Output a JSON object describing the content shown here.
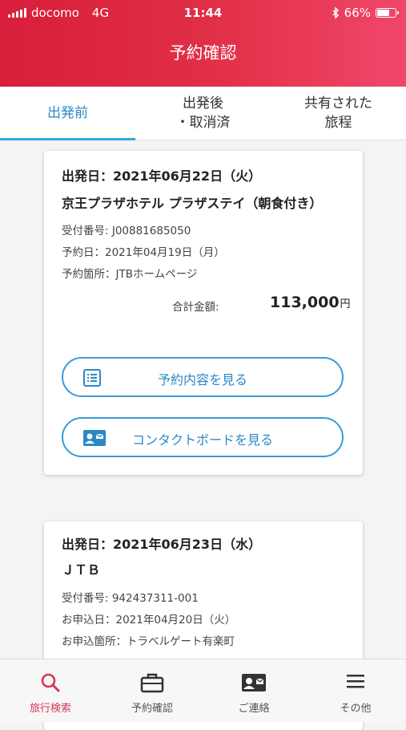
{
  "status_bar": {
    "carrier": "docomo",
    "network": "4G",
    "time": "11:44",
    "battery": "66%"
  },
  "header": {
    "title": "予約確認",
    "bg_colors": [
      "#d81e3a",
      "#f0476a"
    ]
  },
  "tabs": [
    {
      "line1": "出発前",
      "line2": "",
      "active": true
    },
    {
      "line1": "出発後",
      "line2": "・取消済",
      "active": false
    },
    {
      "line1": "共有された",
      "line2": "旅程",
      "active": false
    }
  ],
  "bookings": [
    {
      "date": "出発日：2021年06月22日（火）",
      "hotel": "京王プラザホテル プラザステイ（朝食付き）",
      "receipt": "受付番号: J00881685050",
      "booked": "予約日：2021年04月19日（月）",
      "channel": "予約箇所：JTBホームページ",
      "total_label": "合計金額:",
      "total_amount": "113,000",
      "total_unit": "円",
      "details_button": "予約内容を見る",
      "contact_button": "コンタクトボードを見る"
    },
    {
      "date": "出発日：2021年06月23日（水）",
      "hotel": "ＪＴＢ",
      "receipt": "受付番号: 942437311-001",
      "booked": "お申込日：2021年04月20日（火）",
      "channel": "お申込箇所：トラベルゲート有楽町"
    }
  ],
  "bottom_nav": [
    {
      "label": "旅行検索",
      "icon": "search-icon",
      "active": true
    },
    {
      "label": "予約確認",
      "icon": "briefcase-icon",
      "active": false
    },
    {
      "label": "ご連絡",
      "icon": "contact-card-icon",
      "active": false
    },
    {
      "label": "その他",
      "icon": "menu-icon",
      "active": false
    }
  ],
  "colors": {
    "accent_blue": "#2c88c7",
    "active_nav": "#d3365b"
  }
}
